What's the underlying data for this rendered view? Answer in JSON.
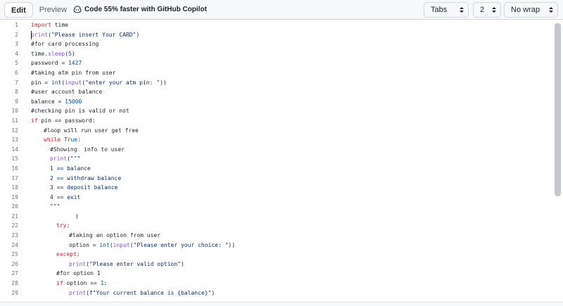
{
  "toolbar": {
    "edit_label": "Edit",
    "preview_label": "Preview",
    "copilot_text": "Code 55% faster with GitHub Copilot",
    "indent_mode": "Tabs",
    "indent_size": "2",
    "wrap_mode": "No wrap"
  },
  "editor": {
    "lines": [
      {
        "n": "1",
        "indent": 0,
        "tokens": [
          {
            "t": "import",
            "c": "kw"
          },
          {
            "t": " time",
            "c": ""
          }
        ]
      },
      {
        "n": "2",
        "indent": 0,
        "tokens": [
          {
            "t": "print",
            "c": "fn"
          },
          {
            "t": "(",
            "c": ""
          },
          {
            "t": "\"Please insert Your CARD\"",
            "c": "str"
          },
          {
            "t": ")",
            "c": ""
          }
        ]
      },
      {
        "n": "3",
        "indent": 0,
        "tokens": [
          {
            "t": "#for card processing",
            "c": ""
          }
        ]
      },
      {
        "n": "4",
        "indent": 0,
        "tokens": [
          {
            "t": "time.",
            "c": ""
          },
          {
            "t": "sleep",
            "c": "fn"
          },
          {
            "t": "(",
            "c": ""
          },
          {
            "t": "5",
            "c": "num"
          },
          {
            "t": ")",
            "c": ""
          }
        ]
      },
      {
        "n": "5",
        "indent": 0,
        "tokens": [
          {
            "t": "password = ",
            "c": ""
          },
          {
            "t": "1427",
            "c": "num"
          }
        ]
      },
      {
        "n": "6",
        "indent": 0,
        "tokens": [
          {
            "t": "#taking atm pin from user",
            "c": ""
          }
        ]
      },
      {
        "n": "7",
        "indent": 0,
        "tokens": [
          {
            "t": "pin = ",
            "c": ""
          },
          {
            "t": "int",
            "c": "bi"
          },
          {
            "t": "(",
            "c": ""
          },
          {
            "t": "input",
            "c": "fn"
          },
          {
            "t": "(",
            "c": ""
          },
          {
            "t": "\"enter your atm pin: \"",
            "c": "str"
          },
          {
            "t": "))",
            "c": ""
          }
        ]
      },
      {
        "n": "8",
        "indent": 0,
        "tokens": [
          {
            "t": "#user account balance",
            "c": ""
          }
        ]
      },
      {
        "n": "9",
        "indent": 0,
        "tokens": [
          {
            "t": "balance = ",
            "c": ""
          },
          {
            "t": "15000",
            "c": "num"
          }
        ]
      },
      {
        "n": "10",
        "indent": 0,
        "tokens": [
          {
            "t": "#checking pin is valid or not",
            "c": ""
          }
        ]
      },
      {
        "n": "11",
        "indent": 0,
        "tokens": [
          {
            "t": "if",
            "c": "kw"
          },
          {
            "t": " pin == password:",
            "c": ""
          }
        ]
      },
      {
        "n": "12",
        "indent": 2,
        "tokens": [
          {
            "t": "#loop will run user get free",
            "c": ""
          }
        ]
      },
      {
        "n": "13",
        "indent": 2,
        "tokens": [
          {
            "t": "while",
            "c": "kw"
          },
          {
            "t": " ",
            "c": ""
          },
          {
            "t": "True",
            "c": "bi"
          },
          {
            "t": ":",
            "c": ""
          }
        ]
      },
      {
        "n": "14",
        "indent": 3,
        "tokens": [
          {
            "t": "#Showing  info to user",
            "c": ""
          }
        ]
      },
      {
        "n": "15",
        "indent": 3,
        "tokens": [
          {
            "t": "print",
            "c": "fn"
          },
          {
            "t": "(",
            "c": ""
          },
          {
            "t": "\"\"\"",
            "c": "str"
          }
        ]
      },
      {
        "n": "16",
        "indent": 3,
        "tokens": [
          {
            "t": "1 == balance",
            "c": "str"
          }
        ]
      },
      {
        "n": "17",
        "indent": 3,
        "tokens": [
          {
            "t": "2 == withdraw balance",
            "c": "str"
          }
        ]
      },
      {
        "n": "18",
        "indent": 3,
        "tokens": [
          {
            "t": "3 == deposit balance",
            "c": "str"
          }
        ]
      },
      {
        "n": "19",
        "indent": 3,
        "tokens": [
          {
            "t": "4 == exit",
            "c": "str"
          }
        ]
      },
      {
        "n": "20",
        "indent": 3,
        "tokens": [
          {
            "t": "\"\"\"",
            "c": "str"
          }
        ]
      },
      {
        "n": "21",
        "indent": 7,
        "tokens": [
          {
            "t": ")",
            "c": ""
          }
        ]
      },
      {
        "n": "22",
        "indent": 4,
        "tokens": [
          {
            "t": "try",
            "c": "kw"
          },
          {
            "t": ":",
            "c": ""
          }
        ]
      },
      {
        "n": "23",
        "indent": 6,
        "tokens": [
          {
            "t": "#taking an option from user",
            "c": ""
          }
        ]
      },
      {
        "n": "24",
        "indent": 6,
        "tokens": [
          {
            "t": "option = ",
            "c": ""
          },
          {
            "t": "int",
            "c": "bi"
          },
          {
            "t": "(",
            "c": ""
          },
          {
            "t": "input",
            "c": "fn"
          },
          {
            "t": "(",
            "c": ""
          },
          {
            "t": "\"Please enter your choice: \"",
            "c": "str"
          },
          {
            "t": "))",
            "c": ""
          }
        ]
      },
      {
        "n": "25",
        "indent": 4,
        "tokens": [
          {
            "t": "except",
            "c": "kw"
          },
          {
            "t": ":",
            "c": ""
          }
        ]
      },
      {
        "n": "26",
        "indent": 6,
        "tokens": [
          {
            "t": "print",
            "c": "fn"
          },
          {
            "t": "(",
            "c": ""
          },
          {
            "t": "\"Please enter valid option\"",
            "c": "str"
          },
          {
            "t": ")",
            "c": ""
          }
        ]
      },
      {
        "n": "27",
        "indent": 4,
        "tokens": [
          {
            "t": "#for option 1",
            "c": ""
          }
        ]
      },
      {
        "n": "28",
        "indent": 4,
        "tokens": [
          {
            "t": "if",
            "c": "kw"
          },
          {
            "t": " option == ",
            "c": ""
          },
          {
            "t": "1",
            "c": "num"
          },
          {
            "t": ":",
            "c": ""
          }
        ]
      },
      {
        "n": "29",
        "indent": 6,
        "tokens": [
          {
            "t": "print",
            "c": "fn"
          },
          {
            "t": "(",
            "c": ""
          },
          {
            "t": "f\"Your current balance is {balance}\"",
            "c": "str"
          },
          {
            "t": ")",
            "c": ""
          }
        ]
      }
    ]
  }
}
